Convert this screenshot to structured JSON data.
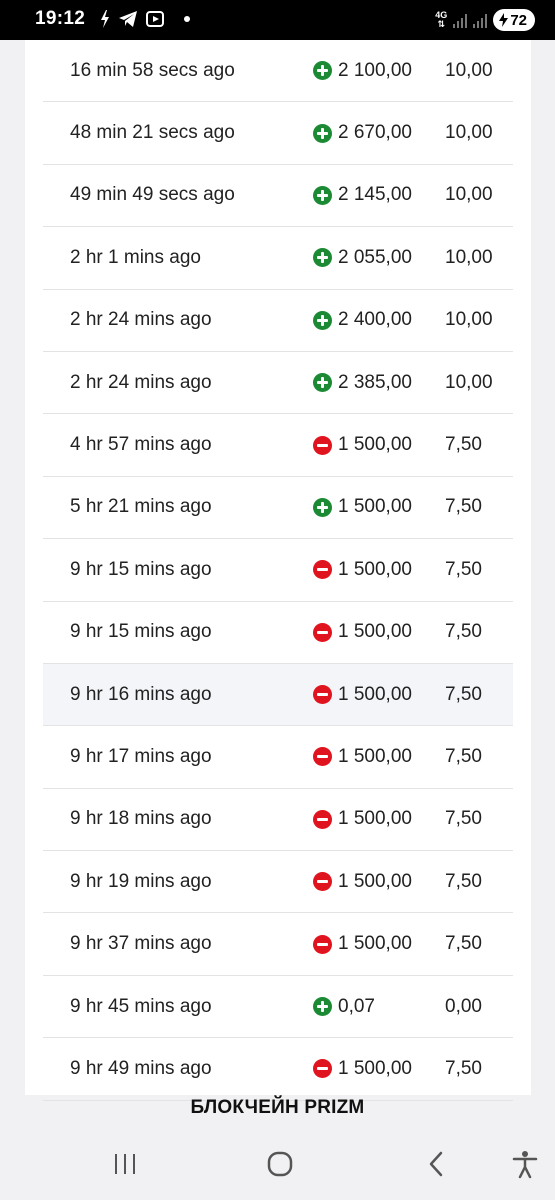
{
  "status_bar": {
    "time": "19:12",
    "network_type": "4G",
    "battery_level": "72"
  },
  "transactions": [
    {
      "time": "16 min 58 secs ago",
      "direction": "incoming",
      "amount": "2 100,00",
      "fee": "10,00"
    },
    {
      "time": "48 min 21 secs ago",
      "direction": "incoming",
      "amount": "2 670,00",
      "fee": "10,00"
    },
    {
      "time": "49 min 49 secs ago",
      "direction": "incoming",
      "amount": "2 145,00",
      "fee": "10,00"
    },
    {
      "time": "2 hr 1 mins ago",
      "direction": "incoming",
      "amount": "2 055,00",
      "fee": "10,00"
    },
    {
      "time": "2 hr 24 mins ago",
      "direction": "incoming",
      "amount": "2 400,00",
      "fee": "10,00"
    },
    {
      "time": "2 hr 24 mins ago",
      "direction": "incoming",
      "amount": "2 385,00",
      "fee": "10,00"
    },
    {
      "time": "4 hr 57 mins ago",
      "direction": "outgoing",
      "amount": "1 500,00",
      "fee": "7,50"
    },
    {
      "time": "5 hr 21 mins ago",
      "direction": "incoming",
      "amount": "1 500,00",
      "fee": "7,50"
    },
    {
      "time": "9 hr 15 mins ago",
      "direction": "outgoing",
      "amount": "1 500,00",
      "fee": "7,50"
    },
    {
      "time": "9 hr 15 mins ago",
      "direction": "outgoing",
      "amount": "1 500,00",
      "fee": "7,50"
    },
    {
      "time": "9 hr 16 mins ago",
      "direction": "outgoing",
      "amount": "1 500,00",
      "fee": "7,50"
    },
    {
      "time": "9 hr 17 mins ago",
      "direction": "outgoing",
      "amount": "1 500,00",
      "fee": "7,50"
    },
    {
      "time": "9 hr 18 mins ago",
      "direction": "outgoing",
      "amount": "1 500,00",
      "fee": "7,50"
    },
    {
      "time": "9 hr 19 mins ago",
      "direction": "outgoing",
      "amount": "1 500,00",
      "fee": "7,50"
    },
    {
      "time": "9 hr 37 mins ago",
      "direction": "outgoing",
      "amount": "1 500,00",
      "fee": "7,50"
    },
    {
      "time": "9 hr 45 mins ago",
      "direction": "incoming",
      "amount": "0,07",
      "fee": "0,00"
    },
    {
      "time": "9 hr 49 mins ago",
      "direction": "outgoing",
      "amount": "1 500,00",
      "fee": "7,50"
    }
  ],
  "highlighted_row": 10,
  "footer_caption": "БЛОКЧЕЙН PRIZM",
  "colors": {
    "incoming": "#1c8a34",
    "outgoing": "#e0141e",
    "row_highlight": "#f4f5f8"
  },
  "nav_icons": [
    "recent-apps-icon",
    "home-icon",
    "back-icon",
    "accessibility-icon"
  ]
}
